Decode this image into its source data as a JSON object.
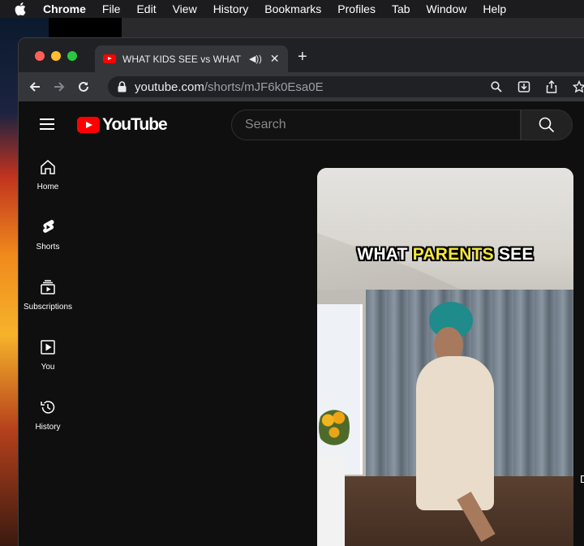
{
  "menubar": {
    "items": [
      "Chrome",
      "File",
      "Edit",
      "View",
      "History",
      "Bookmarks",
      "Profiles",
      "Tab",
      "Window",
      "Help"
    ]
  },
  "browser": {
    "tab": {
      "title": "WHAT KIDS SEE vs WHAT P",
      "favicon": "youtube-favicon",
      "audio_icon": "speaker-icon"
    },
    "address": {
      "host": "youtube.com",
      "path": "/shorts/mJF6k0Esa0E"
    }
  },
  "youtube": {
    "logo_text": "YouTube",
    "search_placeholder": "Search",
    "guide": [
      {
        "label": "Home",
        "icon": "home-icon"
      },
      {
        "label": "Shorts",
        "icon": "shorts-icon"
      },
      {
        "label": "Subscriptions",
        "icon": "subscriptions-icon"
      },
      {
        "label": "You",
        "icon": "you-icon"
      },
      {
        "label": "History",
        "icon": "history-icon"
      }
    ],
    "short": {
      "caption_prefix": "WHAT",
      "caption_highlight": "PARENTS",
      "caption_suffix": "SEE"
    },
    "edge_glyph": "D"
  },
  "colors": {
    "brand_red": "#ff0000",
    "caption_highlight": "#f5e83a"
  }
}
